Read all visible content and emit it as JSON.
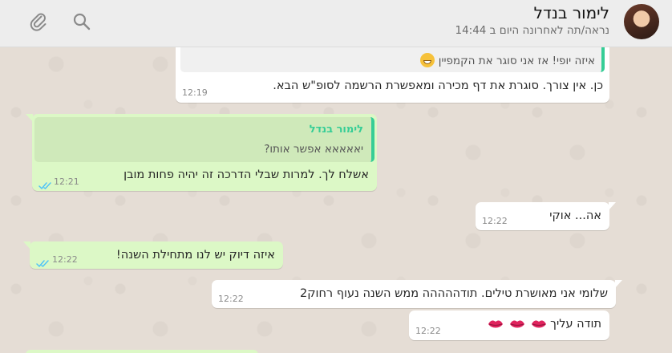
{
  "header": {
    "contact_name": "לימור בנדל",
    "status": "נראה/תה לאחרונה היום ב 14:44",
    "icons": [
      "paperclip-icon",
      "search-icon"
    ]
  },
  "messages": [
    {
      "direction": "incoming",
      "quote_text": "איזה יופי! אז אני סוגר את הקמפיין",
      "quote_emoji": "grinning-face-emoji",
      "text": "כן. אין צורך. סוגרת את דף מכירה ומאפשרת הרשמה לסופ\"ש הבא.",
      "time": "12:19"
    },
    {
      "direction": "outgoing",
      "quote_name": "לימור בנדל",
      "quote_text": "יאאאאא אפשר אותו?",
      "text": "אשלח לך. למרות שבלי הדרכה זה יהיה פחות מובן",
      "time": "12:21",
      "status": "read"
    },
    {
      "direction": "incoming",
      "text": "אה... אוקי",
      "time": "12:22"
    },
    {
      "direction": "outgoing",
      "text": "איזה דיוק יש לנו מתחילת השנה!",
      "time": "12:22",
      "status": "read"
    },
    {
      "direction": "incoming",
      "text": "שלומי אני מאושרת טילים. תודההההה ממש השנה נעוף רחוק2",
      "time": "12:22"
    },
    {
      "direction": "incoming",
      "text": "תודה עליך",
      "emoji": [
        "kiss-mark-emoji",
        "kiss-mark-emoji",
        "kiss-mark-emoji"
      ],
      "time": "12:22"
    }
  ],
  "colors": {
    "chat_background": "#e5ddd5",
    "incoming_bubble": "#ffffff",
    "outgoing_bubble": "#dcf8c6",
    "header_background": "#ededed",
    "quote_accent": "#35cd96",
    "read_ticks": "#4fc3f7"
  }
}
